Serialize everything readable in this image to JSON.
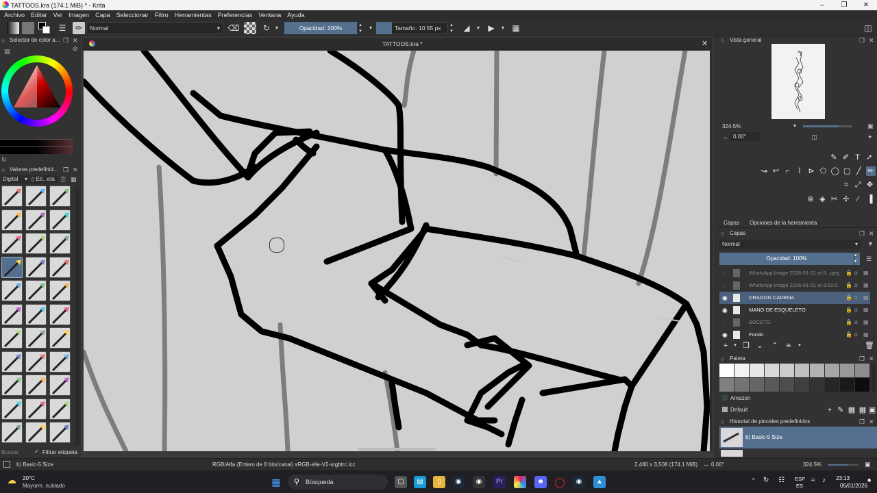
{
  "window": {
    "title": "TATTOOS.kra (174.1 MiB)  * - Krita"
  },
  "menu": [
    "Archivo",
    "Editar",
    "Ver",
    "Imagen",
    "Capa",
    "Seleccionar",
    "Filtro",
    "Herramientas",
    "Preferencias",
    "Ventana",
    "Ayuda"
  ],
  "toolbar": {
    "blend_mode": "Normal",
    "opacity": "Opacidad: 100%",
    "size": "Tamaño: 10.55 px"
  },
  "left": {
    "color_docker_title": "Selector de color a...",
    "presets_docker_title": "Valores predefinid...",
    "preset_tag": "Digital",
    "preset_filter": "Eti...eta",
    "search_placeholder": "Buscar",
    "filter_tag_label": "Filtrar etiqueta"
  },
  "canvas": {
    "tab_title": "TATTOOS.kra *"
  },
  "overview": {
    "title": "Vista general",
    "zoom": "324.5%",
    "rotation": "0.00°"
  },
  "layers": {
    "tab_layers": "Capas",
    "tab_tool_options": "Opciones de la herramienta",
    "title": "Capas",
    "blend_mode": "Normal",
    "opacity": "Opacidad:  100%",
    "items": [
      {
        "name": "WhatsApp Image 2026-01-01 at 9...jpeg",
        "visible": false,
        "active": false
      },
      {
        "name": "WhatsApp Image 2026-01-01 at 9:18:0...",
        "visible": false,
        "active": false
      },
      {
        "name": "DRAGON CADENA",
        "visible": true,
        "active": true
      },
      {
        "name": "MANO DE ESQUELETO",
        "visible": true,
        "active": false
      },
      {
        "name": "BOCETO",
        "visible": false,
        "active": false
      },
      {
        "name": "Fondo",
        "visible": true,
        "active": false
      }
    ]
  },
  "palette": {
    "title": "Paleta",
    "swatches": [
      "#ffffff",
      "#f2f2f2",
      "#e6e6e6",
      "#d9d9d9",
      "#cccccc",
      "#bfbfbf",
      "#b3b3b3",
      "#a6a6a6",
      "#999999",
      "#8c8c8c",
      "#808080",
      "#737373",
      "#666666",
      "#595959",
      "#4d4d4d",
      "#404040",
      "#333333",
      "#262626",
      "#1a1a1a",
      "#0d0d0d"
    ],
    "group_label": "Amazon",
    "palette_name": "Default"
  },
  "brush_history": {
    "title": "Historial de pinceles predefinidos",
    "item": "b) Basic-5 Size"
  },
  "status": {
    "brush": "b) Basic-5 Size",
    "color_space": "RGB/Alfa (Entero de 8 bits/canal)  sRGB-elle-V2-srgbtrc.icc",
    "dimensions": "2,480 x 3,508 (174.1 MiB)",
    "rotation": "0.00°",
    "zoom": "324.5%"
  },
  "taskbar": {
    "temperature": "20°C",
    "weather": "Mayorm. nublado",
    "search": "Búsqueda",
    "lang1": "ESP",
    "lang2": "ES",
    "time": "23:13",
    "date": "05/01/2026"
  },
  "colors": {
    "accent": "#55708f",
    "active_layer": "#4a607c",
    "canvas_bg": "#d0d0d0"
  }
}
